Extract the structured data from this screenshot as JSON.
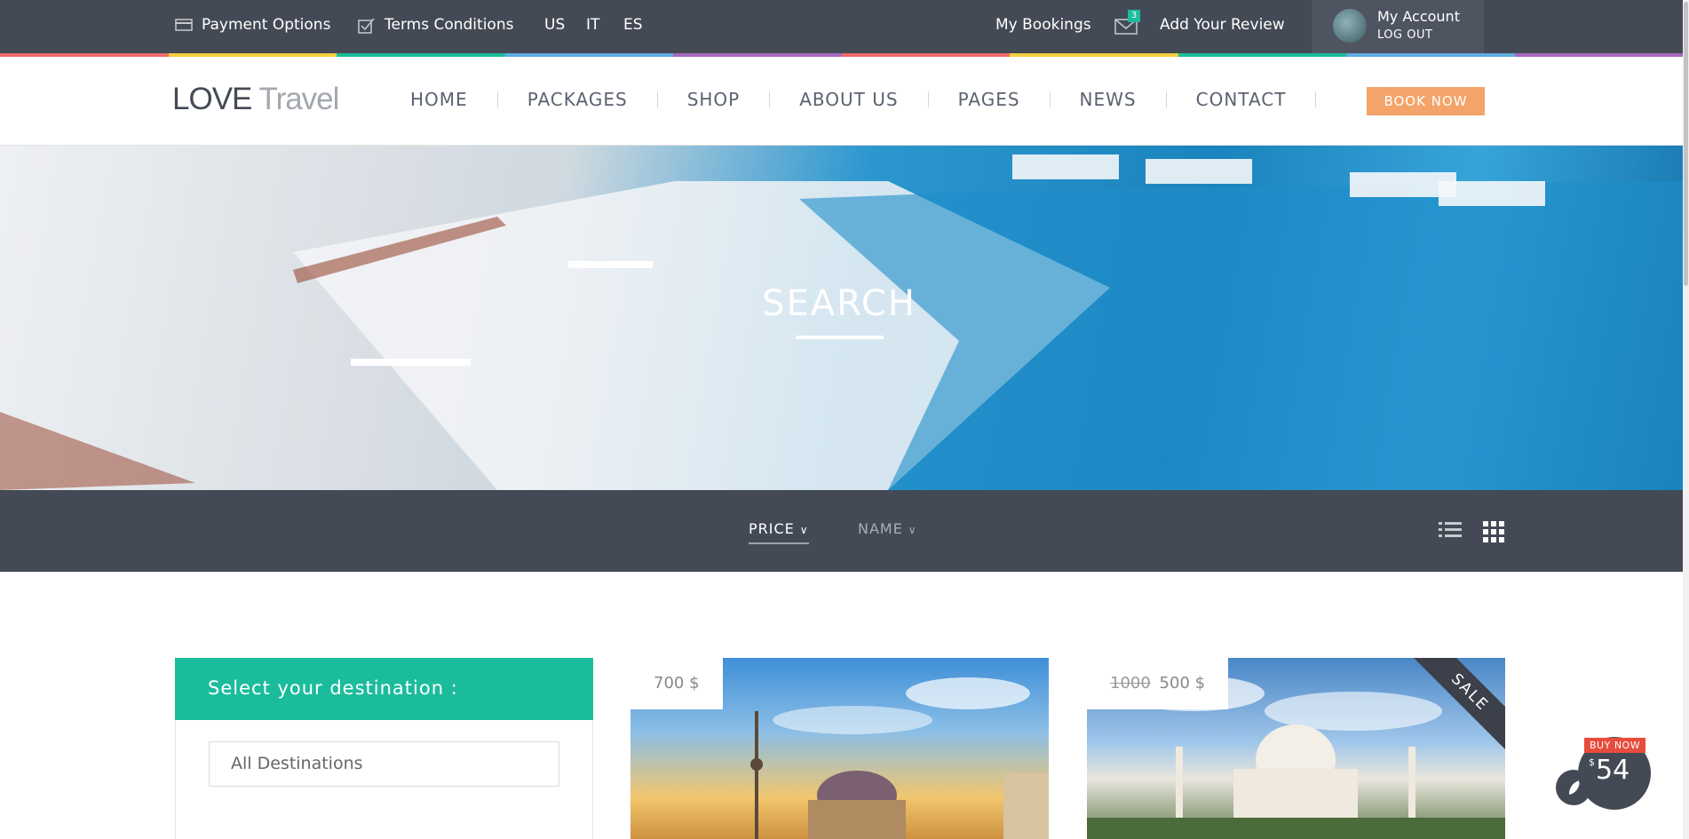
{
  "topbar": {
    "payment_options": "Payment Options",
    "terms_conditions": "Terms Conditions",
    "languages": [
      "US",
      "IT",
      "ES"
    ],
    "my_bookings": "My Bookings",
    "mail_count": "3",
    "add_review": "Add Your Review",
    "account_name": "My Account",
    "logout": "LOG OUT"
  },
  "logo": {
    "part1": "LOVE",
    "part2": "Travel"
  },
  "nav": {
    "items": [
      "HOME",
      "PACKAGES",
      "SHOP",
      "ABOUT US",
      "PAGES",
      "NEWS",
      "CONTACT"
    ],
    "book_now": "BOOK NOW"
  },
  "hero": {
    "title": "SEARCH"
  },
  "sort": {
    "price": "PRICE",
    "name": "NAME"
  },
  "sidebar": {
    "heading": "Select your destination :",
    "destination_value": "All Destinations"
  },
  "cards": [
    {
      "price": "700 $"
    },
    {
      "old_price": "1000",
      "price": "500 $",
      "ribbon": "SALE"
    }
  ],
  "buy_now": {
    "label": "BUY NOW",
    "currency": "$",
    "price": "54"
  },
  "colors": {
    "dark": "#444a55",
    "accent_green": "#1bbc9b",
    "accent_orange": "#f4a46a",
    "buy_red": "#e74c3c"
  }
}
